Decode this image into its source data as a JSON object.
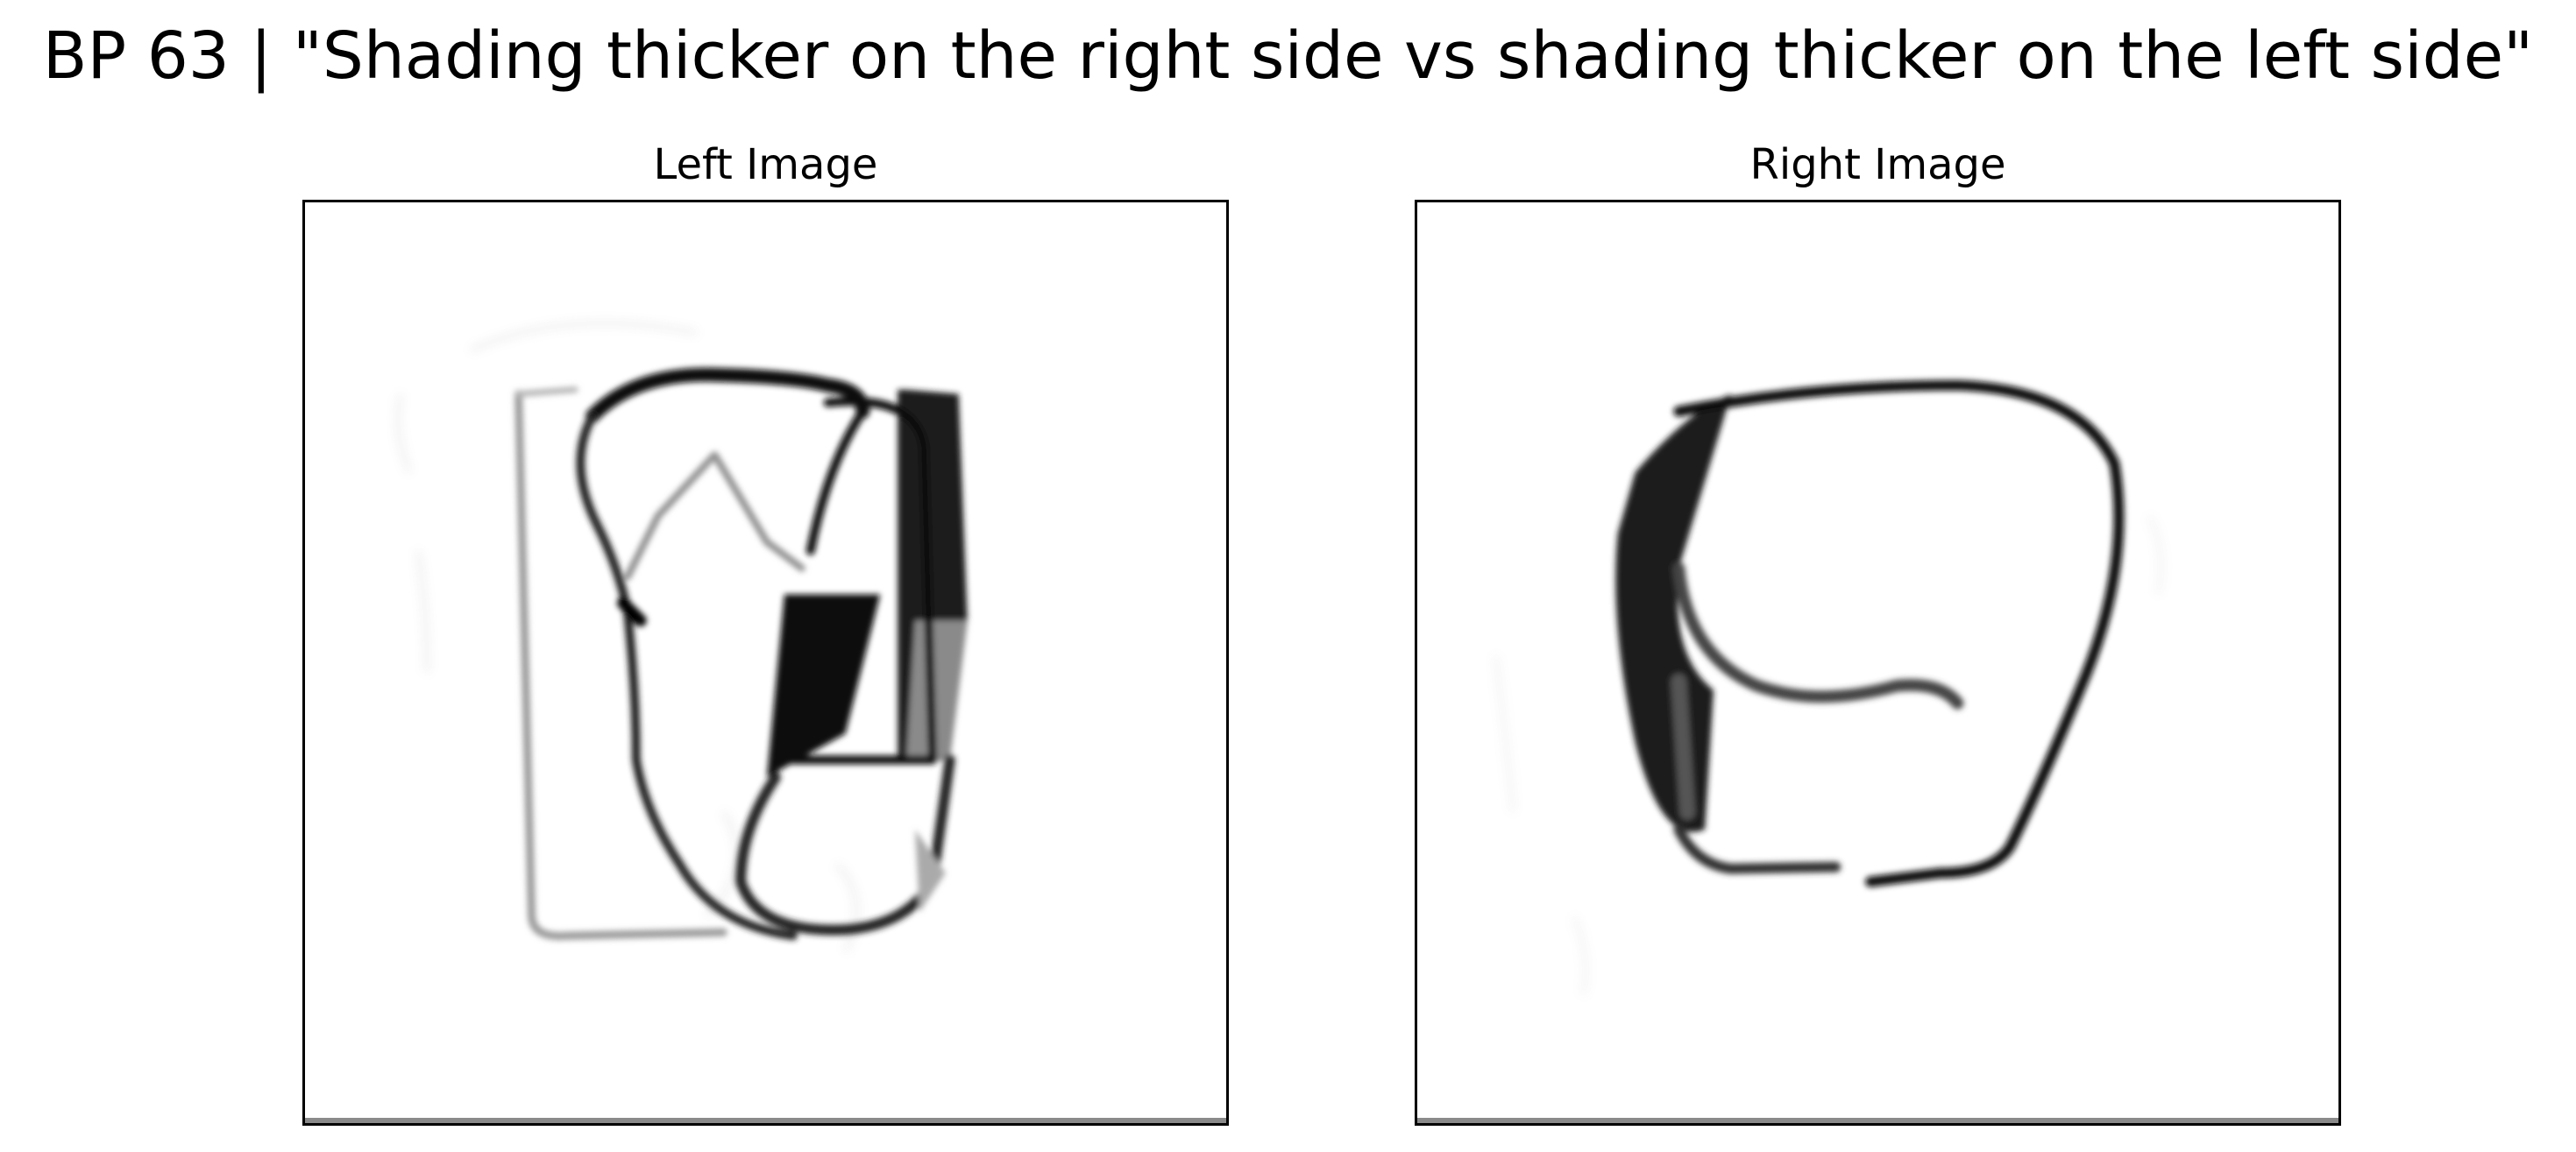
{
  "figure": {
    "title": "BP 63 | \"Shading thicker on the right side vs shading thicker on the left side\""
  },
  "panels": [
    {
      "title": "Left Image",
      "image_content": "Bongard problem sketch: stacked rounded rectangles, dark shading thicker on the right side"
    },
    {
      "title": "Right Image",
      "image_content": "Bongard problem sketch: rounded loop shape, dark shading thicker on the left side"
    }
  ]
}
